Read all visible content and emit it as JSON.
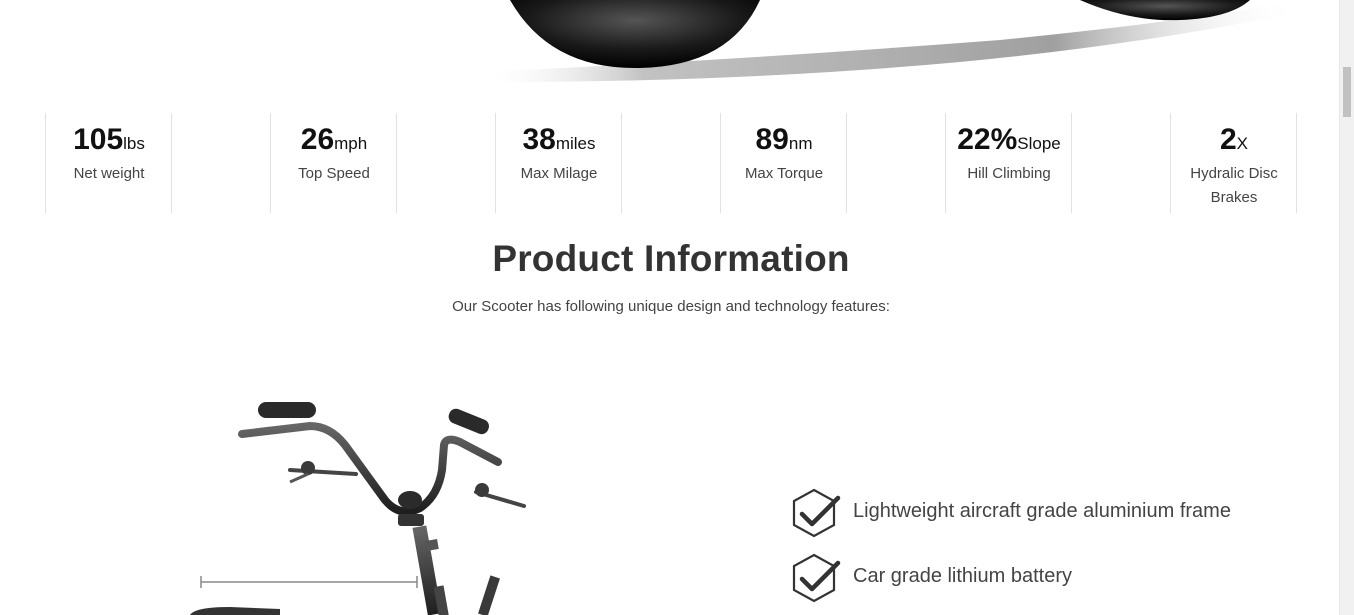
{
  "stats": [
    {
      "value": "105",
      "unit": "lbs",
      "label": "Net weight"
    },
    {
      "value": "26",
      "unit": "mph",
      "label": "Top Speed"
    },
    {
      "value": "38",
      "unit": "miles",
      "label": "Max Milage"
    },
    {
      "value": "89",
      "unit": "nm",
      "label": "Max Torque"
    },
    {
      "value": "22%",
      "unit": "Slope",
      "label": "Hill Climbing"
    },
    {
      "value": "2",
      "unit": "X",
      "label": "Hydralic Disc Brakes"
    }
  ],
  "section": {
    "title": "Product Information",
    "subtitle": "Our Scooter has following unique design and technology features:"
  },
  "features": [
    {
      "icon": "check-hexagon-icon",
      "text": "Lightweight aircraft grade aluminium frame"
    },
    {
      "icon": "check-hexagon-icon",
      "text": "Car grade lithium battery"
    }
  ],
  "colors": {
    "accent": "#333333",
    "divider": "#e2e2e2",
    "text": "#444444"
  }
}
